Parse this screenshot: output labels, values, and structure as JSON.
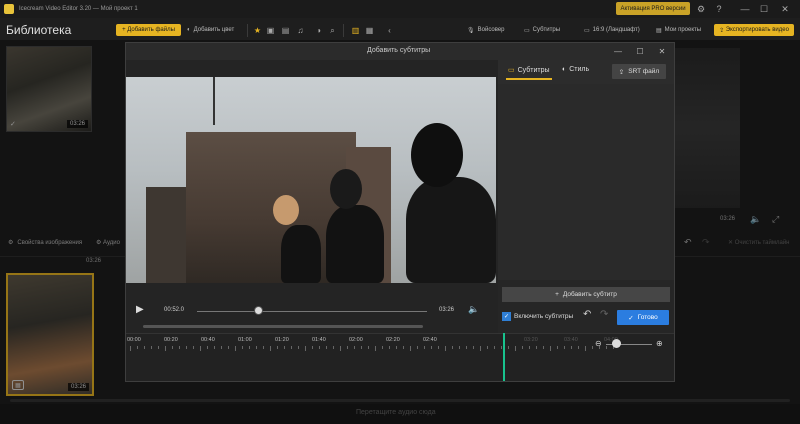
{
  "app": {
    "title": "Icecream Video Editor 3.20 — Мой проект 1",
    "pro_button": "Активация PRO версии"
  },
  "toolbar": {
    "library_title": "Библиотека",
    "add_files": "Добавить файлы",
    "add_color": "Добавить цвет",
    "voiceover": "Войсовер",
    "subtitles": "Субтитры",
    "aspect": "16:9 (Ландшафт)",
    "my_projects": "Мои проекты",
    "export": "Экспортировать видео"
  },
  "library": {
    "thumb_duration": "03:26"
  },
  "preview": {
    "time": "03:26"
  },
  "middle": {
    "image_props": "Свойства изображения",
    "audio": "Аудио",
    "clear_timeline": "Очистить таймлайн"
  },
  "timeline": {
    "ruler_label": "03:26",
    "clip_duration": "03:26",
    "audio_drop": "Перетащите аудио сюда"
  },
  "dialog": {
    "title": "Добавить субтитры",
    "current_time": "00:52.0",
    "end_time": "03:26",
    "seek_progress": 0.27,
    "ruler_ticks": [
      "00:00",
      "00:20",
      "00:40",
      "01:00",
      "01:20",
      "01:40",
      "02:00",
      "02:20",
      "02:40",
      "03:20",
      "03:40",
      "04:00"
    ],
    "tabs": {
      "subtitles": "Субтитры",
      "style": "Стиль"
    },
    "srt_button": "SRT файл",
    "add_subtitle": "Добавить субтитр",
    "enable_subtitles": "Включить субтитры",
    "done": "Готово"
  },
  "colors": {
    "accent": "#e6b422",
    "done": "#2b7de0",
    "playhead": "#18c28d"
  }
}
